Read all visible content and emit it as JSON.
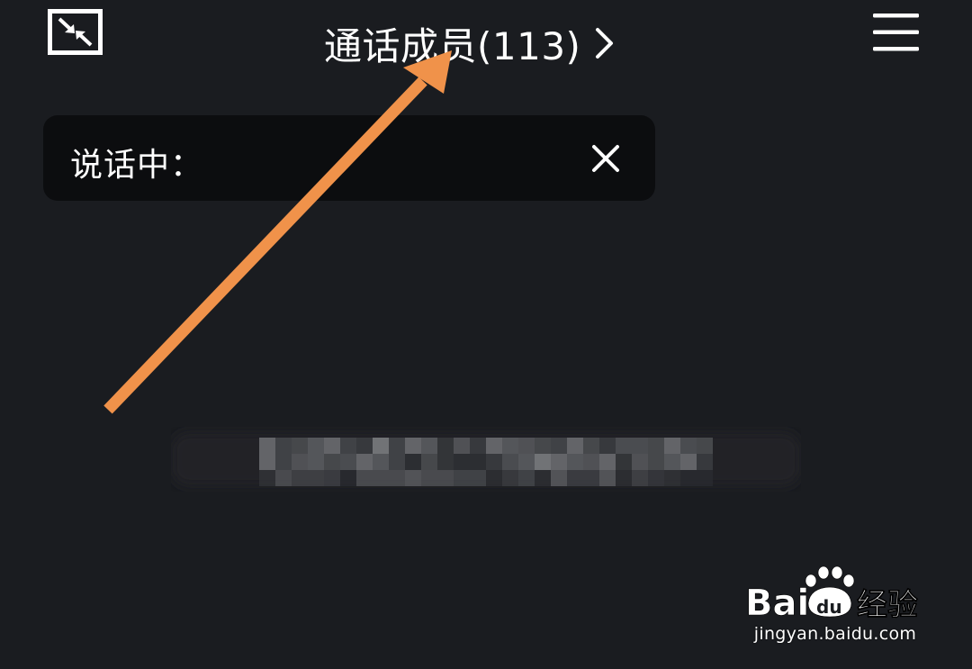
{
  "header": {
    "title": "通话成员(113)",
    "minimize_icon": "minimize-window-icon",
    "chevron_icon": "chevron-right-icon",
    "menu_icon": "hamburger-menu-icon"
  },
  "speaking_banner": {
    "label": "说话中：",
    "close_icon": "close-icon"
  },
  "participant": {
    "name_obscured": true
  },
  "annotation": {
    "color": "#f0924a"
  },
  "watermark": {
    "brand": "Bai",
    "brand_suffix": "du",
    "product": "经验",
    "domain": "jingyan.baidu.com"
  },
  "colors": {
    "background": "#1a1c20",
    "banner": "#0c0d0f",
    "text": "#ffffff"
  }
}
